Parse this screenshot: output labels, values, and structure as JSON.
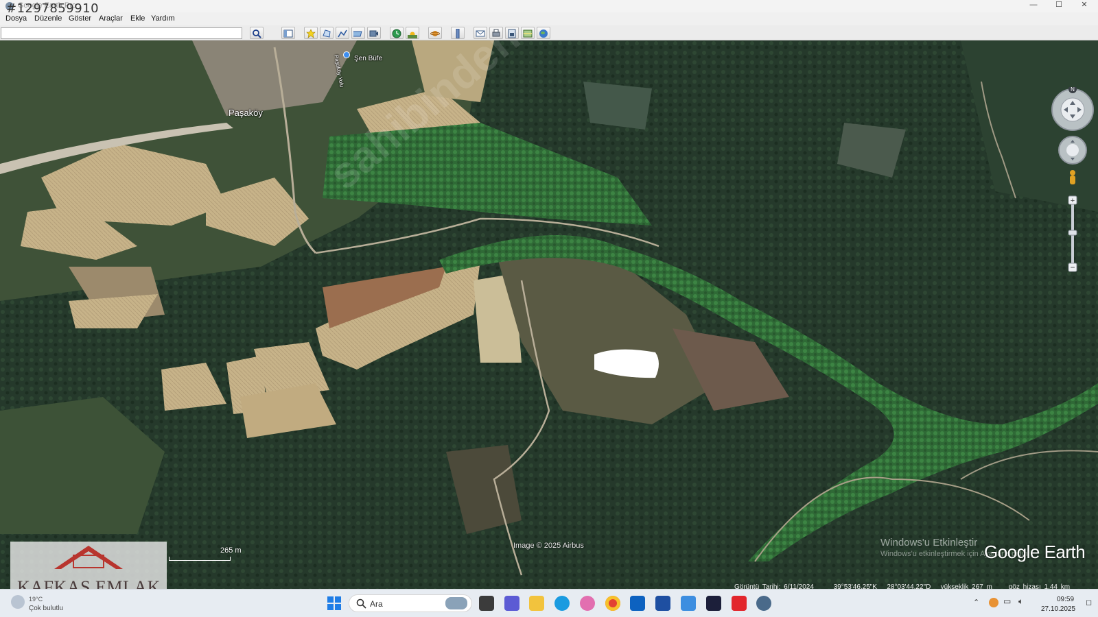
{
  "window": {
    "title": "Google Earth Pro",
    "listing_id": "#1297859910",
    "controls": {
      "minimize": "—",
      "maximize": "☐",
      "close": "✕"
    }
  },
  "menu": [
    "Dosya",
    "Düzenle",
    "Göster",
    "Araçlar",
    "Ekle",
    "Yardım"
  ],
  "search": {
    "value": "",
    "placeholder": ""
  },
  "toolbar_icons": [
    "sidebar-icon",
    "placemark-icon",
    "polygon-icon",
    "path-icon",
    "image-overlay-icon",
    "record-tour-icon",
    "historical-imagery-icon",
    "sunlight-icon",
    "planets-icon",
    "ruler-icon",
    "email-icon",
    "print-icon",
    "save-image-icon",
    "maps-icon",
    "earth-icon"
  ],
  "map": {
    "place_labels": {
      "village": "Paşaköy",
      "poi": "Şen Büfe",
      "road": "Paşaköy Yolu"
    },
    "credit": "Image © 2025 Airbus",
    "logo": "Google Earth",
    "watermark": "sahibinden.com KAFKAS EMLAK",
    "scale_label": "265 m",
    "activation": {
      "title": "Windows'u Etkinleştir",
      "subtitle": "Windows'u etkinleştirmek için Ayarlar'a gidin."
    },
    "compass_north": "N"
  },
  "status": {
    "imagery_date": "Görüntü Tarihi: 6/11/2024",
    "latitude": "39°53'46.25\"K",
    "longitude": "28°03'44.22\"D",
    "elevation": "yükseklik  267 m",
    "eye_altitude": "göz hizası  1.44 km"
  },
  "agency": {
    "name": "KAFKAS EMLAK"
  },
  "taskbar": {
    "weather_temp": "19°C",
    "weather_desc": "Çok bulutlu",
    "search_label": "Ara",
    "time": "09:59",
    "date": "27.10.2025"
  },
  "colors": {
    "forest": "#253d2b",
    "field": "#c8b48a",
    "river": "#3f8a49",
    "taskbar": "#e7ecf2"
  }
}
